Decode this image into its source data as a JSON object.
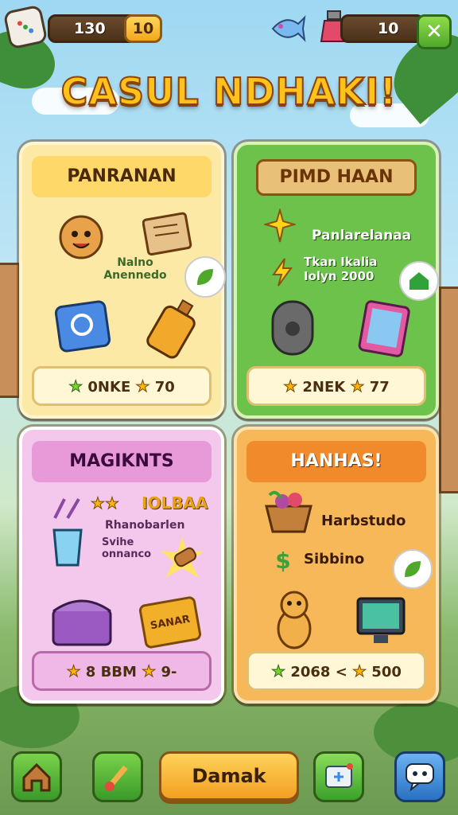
{
  "topbar": {
    "coins": "130",
    "gems": "10",
    "energy": "10",
    "dice_icon": "dice-icon",
    "pet_icon": "fish-icon",
    "potion_icon": "potion-icon",
    "close_label": "✕"
  },
  "title": "CASUL NDHAKI!",
  "cards": [
    {
      "header": "PANRANAN",
      "label": "Nalno\nAnennedo",
      "footer_a": "0NKE",
      "footer_b": "70"
    },
    {
      "header": "PIMD HAAN",
      "label_1": "Panlarelanaa",
      "label_2": "Tkan Ikalia\nIolyn 2000",
      "footer_a": "2NEK",
      "footer_b": "77"
    },
    {
      "header": "MAGIKNTS",
      "label_1": "IOLBAA",
      "label_2": "Rhanobarlen",
      "label_3": "Svihe\nonnanco",
      "ticket": "SANAR",
      "footer_a": "8 BBM",
      "footer_b": "9-"
    },
    {
      "header": "HANHAS!",
      "label_1": "Harbstudo",
      "label_2": "Sibbino",
      "footer_a": "2068 <",
      "footer_b": "500"
    }
  ],
  "bottom_nav": {
    "home_icon": "home-icon",
    "brush_icon": "paintbrush-icon",
    "main_label": "Damak",
    "card_icon": "card-plus-icon",
    "chat_icon": "chat-icon"
  },
  "colors": {
    "title": "#ffc21a",
    "card1": "#fde9a6",
    "card2": "#6cc24a",
    "card3": "#f3c8ec",
    "card4": "#f7b85a"
  }
}
